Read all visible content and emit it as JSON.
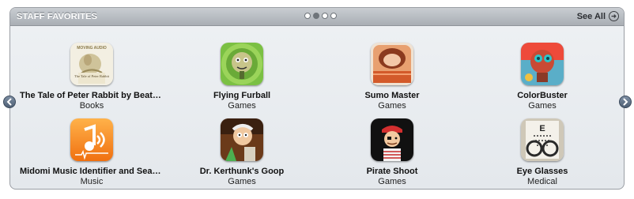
{
  "header": {
    "title": "STAFF FAVORITES",
    "see_all": "See All",
    "page_dots": 4,
    "active_dot": 1
  },
  "apps": [
    {
      "name": "The Tale of Peter Rabbit by Beatrix ...",
      "category": "Books",
      "icon": "book-cover-icon",
      "icon_text_top": "MOVING AUDIO",
      "icon_text_mid": "The Tale of Peter Rabbit"
    },
    {
      "name": "Flying Furball",
      "category": "Games",
      "icon": "furball-game-icon"
    },
    {
      "name": "Sumo Master",
      "category": "Games",
      "icon": "sumo-game-icon"
    },
    {
      "name": "ColorBuster",
      "category": "Games",
      "icon": "robot-game-icon"
    },
    {
      "name": "Midomi Music Identifier and Search (...",
      "category": "Music",
      "icon": "music-note-icon"
    },
    {
      "name": "Dr. Kerthunk's Goop",
      "category": "Games",
      "icon": "scientist-game-icon"
    },
    {
      "name": "Pirate Shoot",
      "category": "Games",
      "icon": "pirate-game-icon"
    },
    {
      "name": "Eye Glasses",
      "category": "Medical",
      "icon": "eye-chart-icon",
      "icon_text": "E"
    }
  ],
  "colors": {
    "header_bg": "#b3b8be",
    "panel_bg": "#e9ecef",
    "nav_arrow": "#5b6b80"
  }
}
